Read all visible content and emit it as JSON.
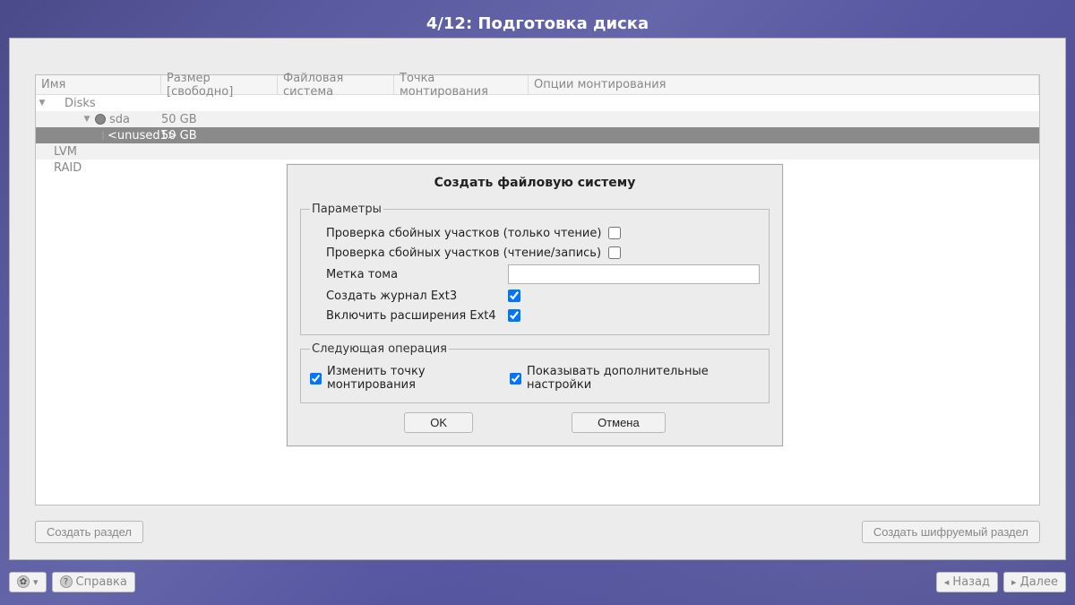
{
  "title": "4/12: Подготовка диска",
  "columns": {
    "name": "Имя",
    "size": "Размер [свободно]",
    "fs": "Файловая система",
    "mount": "Точка монтирования",
    "opts": "Опции монтирования"
  },
  "tree": {
    "disks_label": "Disks",
    "sda_label": "sda",
    "sda_size": "50 GB",
    "unused_label": "<unused1>",
    "unused_size": "50 GB",
    "lvm_label": "LVM",
    "raid_label": "RAID"
  },
  "bottom_buttons": {
    "create": "Создать раздел",
    "create_encrypted": "Создать шифруемый раздел"
  },
  "toolbar": {
    "help": "Справка",
    "back": "Назад",
    "next": "Далее"
  },
  "dialog": {
    "title": "Создать файловую систему",
    "params_legend": "Параметры",
    "check_ro": "Проверка сбойных участков (только чтение)",
    "check_rw": "Проверка сбойных участков (чтение/запись)",
    "volume_label": "Метка тома",
    "volume_value": "",
    "ext3_journal": "Создать журнал Ext3",
    "ext4_ext": "Включить расширения Ext4",
    "next_legend": "Следующая операция",
    "change_mount": "Изменить точку монтирования",
    "show_advanced": "Показывать дополнительные настройки",
    "ok": "OK",
    "cancel": "Отмена"
  }
}
